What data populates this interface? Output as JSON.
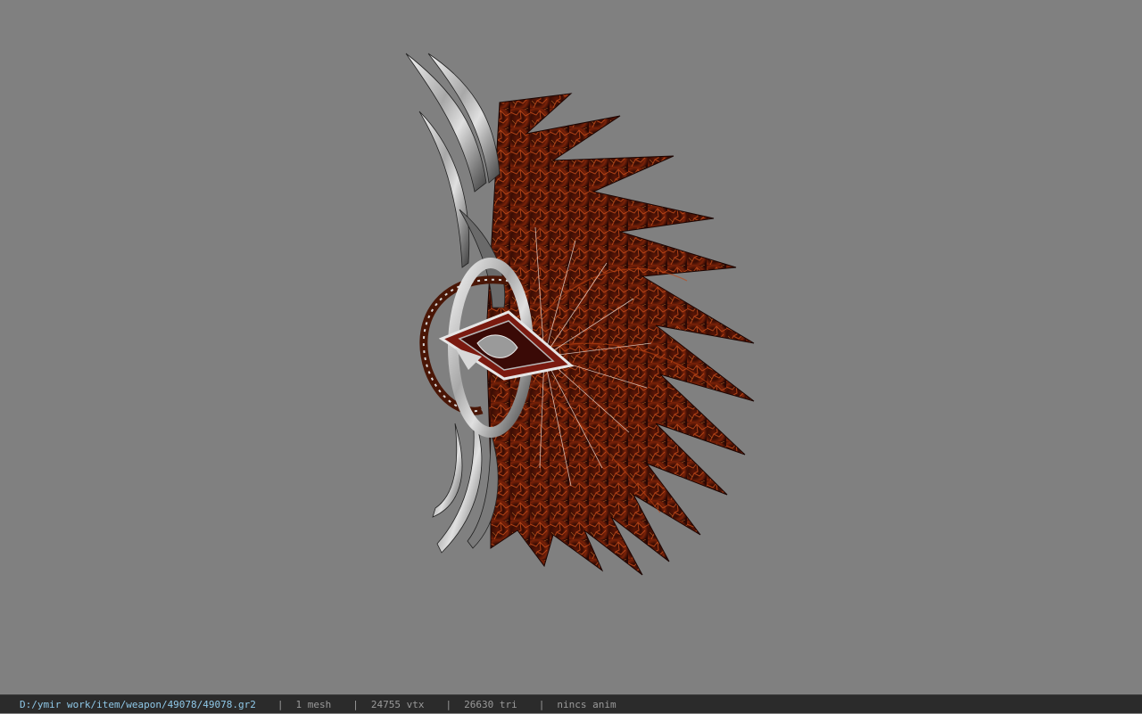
{
  "window": {
    "background_color": "#808080"
  },
  "viewport": {
    "model_description_icon": "weapon-mesh-render",
    "colors": {
      "lava_dark": "#2a0a04",
      "lava_mid": "#7a1e08",
      "lava_glow": "#e0641a",
      "metal_light": "#e8e8e8",
      "metal_dark": "#3a3a3a"
    }
  },
  "statusbar": {
    "path": "D:/ymir work/item/weapon/49078/49078.gr2",
    "separator": "|",
    "mesh_count": "1 mesh",
    "vertex_count": "24755 vtx",
    "triangle_count": "26630 tri",
    "anim_status": "nincs anim",
    "path_color": "#8fc8e8",
    "text_color": "#9a9a9a"
  }
}
